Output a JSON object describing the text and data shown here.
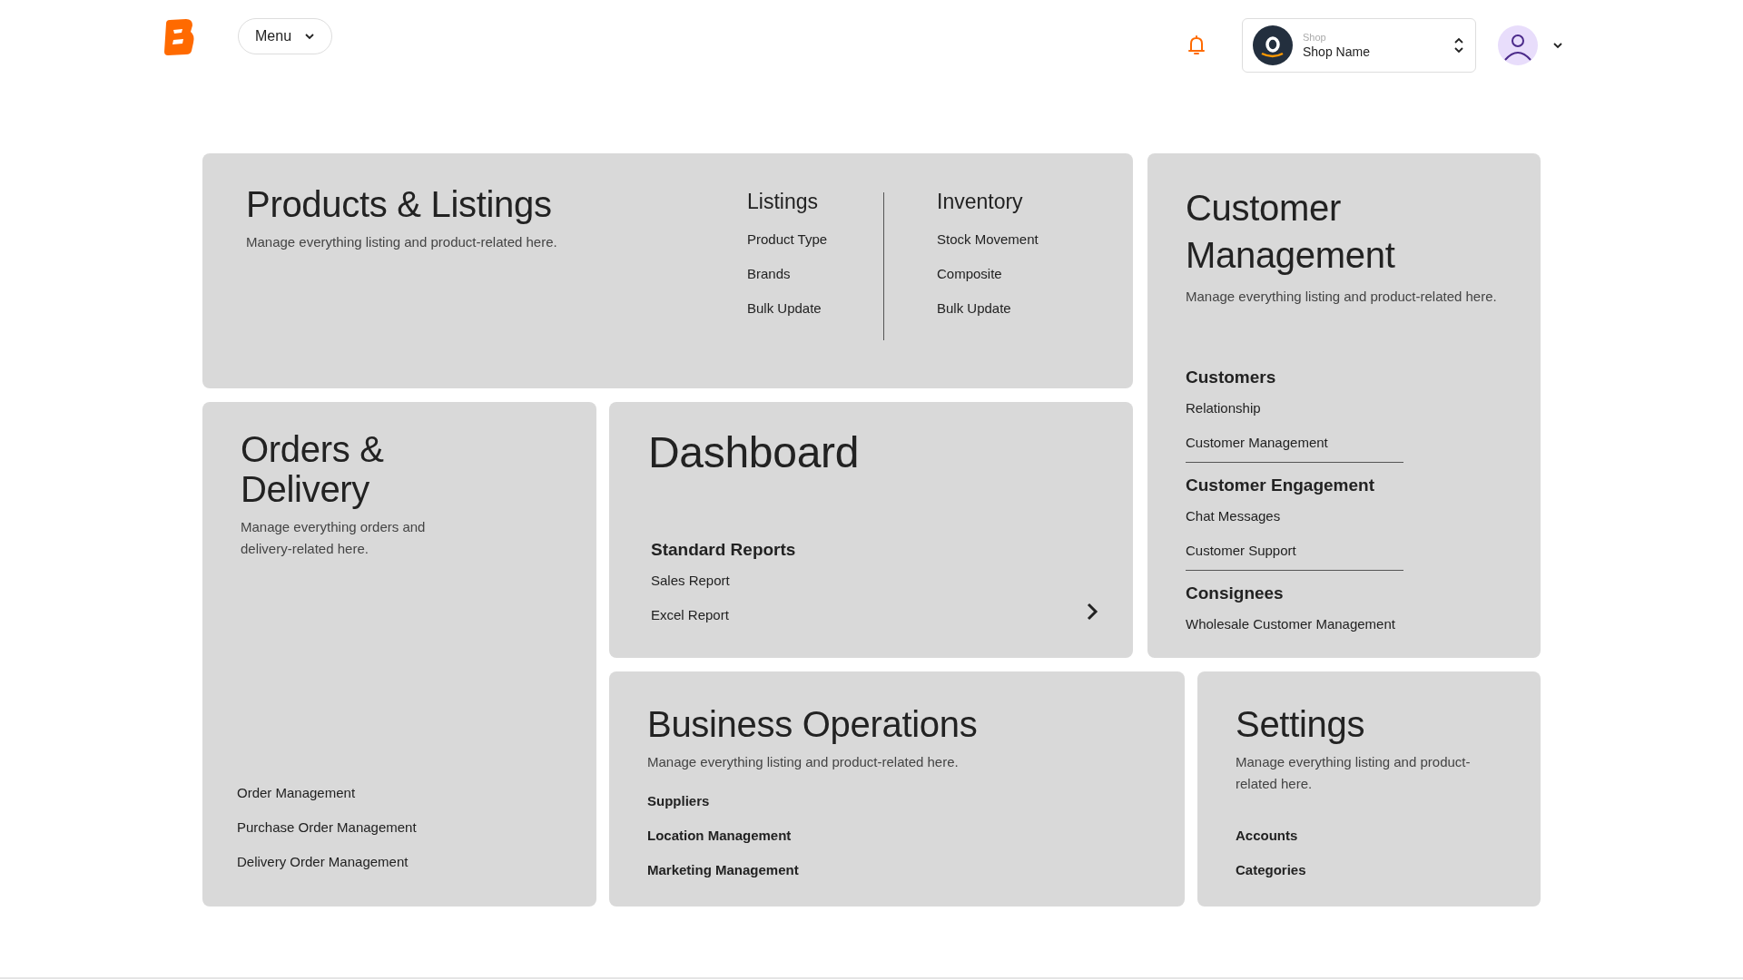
{
  "header": {
    "menu_button": "Menu",
    "shop": {
      "caption": "Shop",
      "name": "Shop Name"
    }
  },
  "products": {
    "title": "Products & Listings",
    "description": "Manage everything listing and product-related here.",
    "columns": [
      {
        "heading": "Listings",
        "links": [
          "Product Type",
          "Brands",
          "Bulk Update"
        ]
      },
      {
        "heading": "Inventory",
        "links": [
          "Stock Movement",
          "Composite",
          "Bulk Update"
        ]
      }
    ]
  },
  "customers": {
    "title": "Customer Management",
    "description": "Manage everything listing and product-related here.",
    "sections": [
      {
        "heading": "Customers",
        "links": [
          "Relationship",
          "Customer Management"
        ]
      },
      {
        "heading": "Customer Engagement",
        "links": [
          "Chat Messages",
          "Customer Support"
        ]
      },
      {
        "heading": "Consignees",
        "links": [
          "Wholesale Customer Management"
        ]
      }
    ]
  },
  "orders": {
    "title": "Orders & Delivery",
    "description": "Manage everything orders and delivery-related here.",
    "links": [
      "Order Management",
      "Purchase Order Management",
      "Delivery Order Management"
    ]
  },
  "dashboard": {
    "title": "Dashboard",
    "section": "Standard Reports",
    "links": [
      "Sales Report",
      "Excel Report"
    ]
  },
  "business": {
    "title": "Business Operations",
    "description": "Manage everything listing and product-related here.",
    "links": [
      "Suppliers",
      "Location Management",
      "Marketing Management"
    ]
  },
  "settings": {
    "title": "Settings",
    "description": "Manage everything listing and product-related here.",
    "links": [
      "Accounts",
      "Categories"
    ]
  }
}
